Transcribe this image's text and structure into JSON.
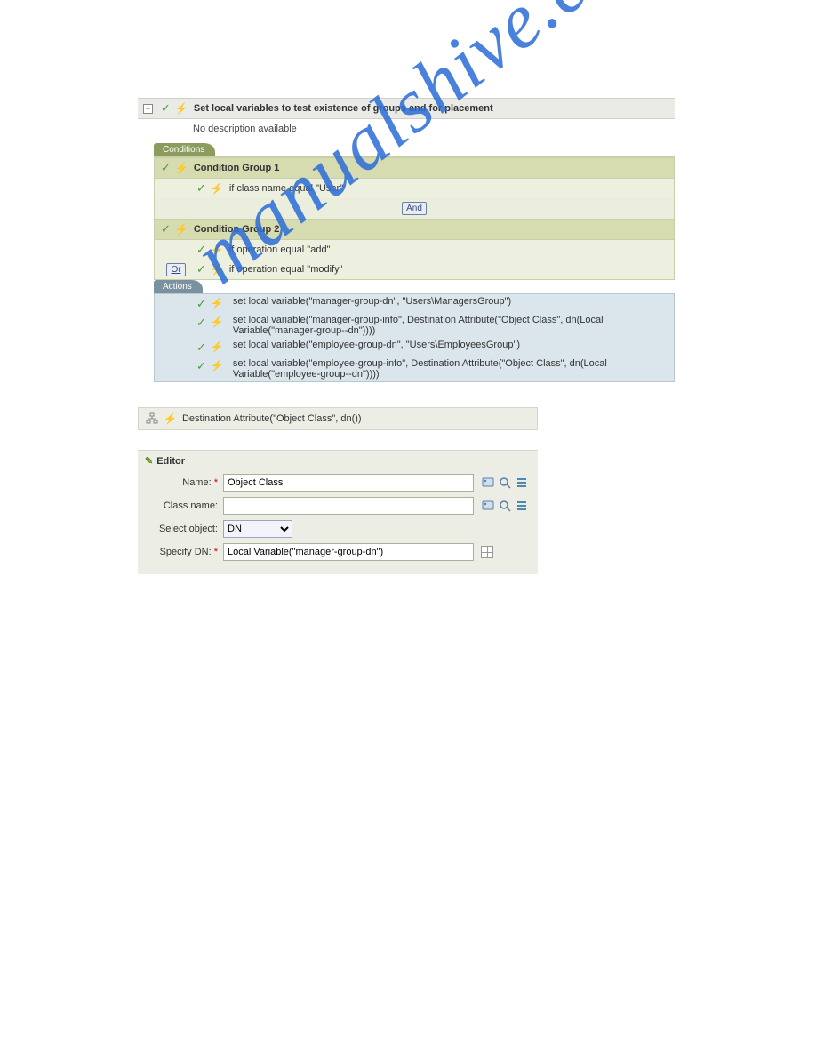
{
  "rule": {
    "title": "Set local variables to test existence of groups and for placement",
    "description": "No description available"
  },
  "tabs": {
    "conditions": "Conditions",
    "actions": "Actions"
  },
  "cond": {
    "g1": {
      "title": "Condition Group 1",
      "r1": "if class name equal \"User\""
    },
    "and": "And",
    "g2": {
      "title": "Condition Group 2",
      "r1": "if operation equal \"add\"",
      "or": "Or",
      "r2": "if operation equal \"modify\""
    }
  },
  "acts": {
    "a1": "set local variable(\"manager-group-dn\", \"Users\\ManagersGroup\")",
    "a2": "set local variable(\"manager-group-info\", Destination Attribute(\"Object Class\", dn(Local Variable(\"manager-group--dn\"))))",
    "a3": "set local variable(\"employee-group-dn\", \"Users\\EmployeesGroup\")",
    "a4": "set local variable(\"employee-group-info\", Destination Attribute(\"Object Class\", dn(Local Variable(\"employee-group--dn\"))))"
  },
  "crumb": {
    "text": "Destination Attribute(\"Object Class\", dn())"
  },
  "editor": {
    "title": "Editor",
    "name_label": "Name:",
    "name_value": "Object Class",
    "class_label": "Class name:",
    "class_value": "",
    "select_label": "Select object:",
    "select_value": "DN",
    "dn_label": "Specify DN:",
    "dn_value": "Local Variable(\"manager-group-dn\")"
  },
  "watermark": "manualshive.com"
}
